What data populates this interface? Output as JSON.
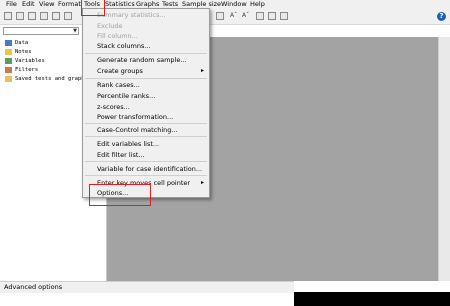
{
  "menubar": {
    "items": [
      "File",
      "Edit",
      "View",
      "Format",
      "Tools",
      "Statistics",
      "Graphs",
      "Tests",
      "Sample size",
      "Window",
      "Help"
    ]
  },
  "help_icon": "?",
  "toolbar": {
    "text_tools": [
      "Aˆ",
      "Aˇ"
    ]
  },
  "sidebar": {
    "items": [
      {
        "label": "Data",
        "icon": "data-icon"
      },
      {
        "label": "Notes",
        "icon": "notes-icon"
      },
      {
        "label": "Variables",
        "icon": "variables-icon"
      },
      {
        "label": "Filters",
        "icon": "filters-icon"
      },
      {
        "label": "Saved tests and graphs",
        "icon": "folder-icon"
      }
    ]
  },
  "tools_menu": {
    "items": [
      {
        "label": "Summary statistics...",
        "enabled": false
      },
      {
        "label": "Exclude",
        "enabled": false
      },
      {
        "label": "Fill column...",
        "enabled": false
      },
      {
        "label": "Stack columns...",
        "enabled": true
      },
      {
        "label": "Generate random sample...",
        "enabled": true
      },
      {
        "label": "Create groups",
        "enabled": true,
        "submenu": true
      },
      {
        "label": "Rank cases...",
        "enabled": true
      },
      {
        "label": "Percentile ranks...",
        "enabled": true
      },
      {
        "label": "z-scores...",
        "enabled": true
      },
      {
        "label": "Power transformation...",
        "enabled": true
      },
      {
        "label": "Case-Control matching...",
        "enabled": true
      },
      {
        "label": "Edit variables list...",
        "enabled": true
      },
      {
        "label": "Edit filter list...",
        "enabled": true
      },
      {
        "label": "Variable for case identification...",
        "enabled": true
      },
      {
        "label": "Enter key moves cell pointer",
        "enabled": true,
        "submenu": true
      },
      {
        "label": "Options...",
        "enabled": true
      }
    ],
    "submenu_arrow": "▸"
  },
  "status_bar": {
    "text": "Advanced options"
  },
  "colors": {
    "highlight": "#e01e1e",
    "workspace": "#a3a3a3"
  }
}
